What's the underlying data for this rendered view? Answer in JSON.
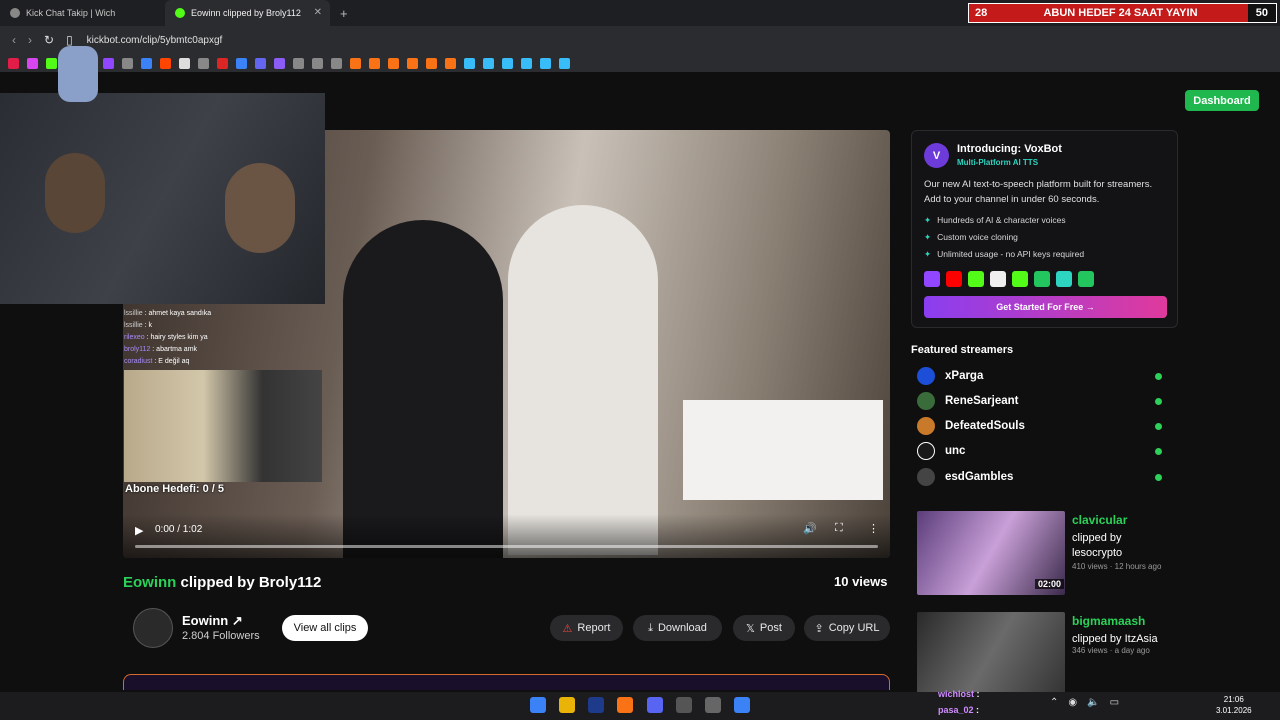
{
  "browser": {
    "tabs": [
      {
        "title": "Kick Chat Takip | Wich",
        "active": false
      },
      {
        "title": "Eowinn clipped by Broly112",
        "active": true
      }
    ],
    "url": "kickbot.com/clip/5ybmtc0apxgf"
  },
  "banner": {
    "left_num": "28",
    "text": "ABUN HEDEF 24 SAAT YAYIN",
    "right_num": "50"
  },
  "header": {
    "dashboard_label": "Dashboard"
  },
  "overlay": {
    "chat_lines": [
      {
        "user": "lssillie",
        "msg": ": ahmet kaya sandıka"
      },
      {
        "user": "lssillie",
        "msg": ": k"
      },
      {
        "user": "rilexeo",
        "msg": ": hairy styles kim ya"
      },
      {
        "user": "broly112",
        "msg": ": abartma amk"
      },
      {
        "user": "coradiust",
        "msg": ": E değil aq"
      }
    ],
    "abone_label": "Abone Hedefi:",
    "abone_value": "0 / 5"
  },
  "player": {
    "time": "0:00 / 1:02",
    "progress": 0
  },
  "clip": {
    "channel": "Eowinn",
    "title_rest": "clipped by Broly112",
    "views": "10 views",
    "followers": "2.804 Followers",
    "view_all_label": "View all clips",
    "actions": {
      "report": "Report",
      "download": "Download",
      "post": "Post",
      "copy": "Copy URL"
    }
  },
  "voxbot": {
    "title": "Introducing: VoxBot",
    "subtitle": "Multi-Platform AI TTS",
    "description": "Our new AI text-to-speech platform built for streamers. Add to your channel in under 60 seconds.",
    "features": [
      "Hundreds of AI & character voices",
      "Custom voice cloning",
      "Unlimited usage - no API keys required"
    ],
    "cta": "Get Started For Free →"
  },
  "featured": {
    "heading": "Featured streamers",
    "streamers": [
      {
        "name": "xParga",
        "color": "#1d4ed8"
      },
      {
        "name": "ReneSarjeant",
        "color": "#3a6b3a"
      },
      {
        "name": "DefeatedSouls",
        "color": "#c87a2a"
      },
      {
        "name": "unc",
        "color": "#ffffff"
      },
      {
        "name": "esdGambles",
        "color": "#444444"
      }
    ]
  },
  "related": [
    {
      "channel": "clavicular",
      "clipped_by": "clipped by lesocrypto",
      "meta": "410 views · 12 hours ago",
      "duration": "02:00"
    },
    {
      "channel": "bigmamaash",
      "clipped_by": "clipped by ItzAsia",
      "meta": "346 views · a day ago",
      "duration": ""
    }
  ],
  "stream_overlay_chat": [
    {
      "user": "wichlost",
      "msg": ":"
    },
    {
      "user": "pasa_02",
      "msg": ":"
    }
  ],
  "system": {
    "time": "21:06",
    "date": "3.01.2026"
  }
}
